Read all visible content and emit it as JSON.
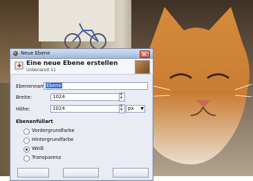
{
  "window": {
    "title": "Neue Ebene"
  },
  "header": {
    "title": "Eine neue Ebene erstellen",
    "subtitle": "Unbenannt-11"
  },
  "form": {
    "name_label": "Ebenenname:",
    "name_value": "Ebene",
    "width_label": "Breite:",
    "width_value": "1024",
    "height_label": "Höhe:",
    "height_value": "1024",
    "unit_value": "px"
  },
  "fill": {
    "title": "Ebenenfüllart",
    "options": [
      {
        "label": "Vordergrundfarbe",
        "selected": false
      },
      {
        "label": "Hintergrundfarbe",
        "selected": false
      },
      {
        "label": "Weiß",
        "selected": true
      },
      {
        "label": "Transparenz",
        "selected": false
      }
    ]
  },
  "icons": {
    "title": "gimp-icon",
    "header": "new-layer-icon",
    "close": "close-icon"
  }
}
